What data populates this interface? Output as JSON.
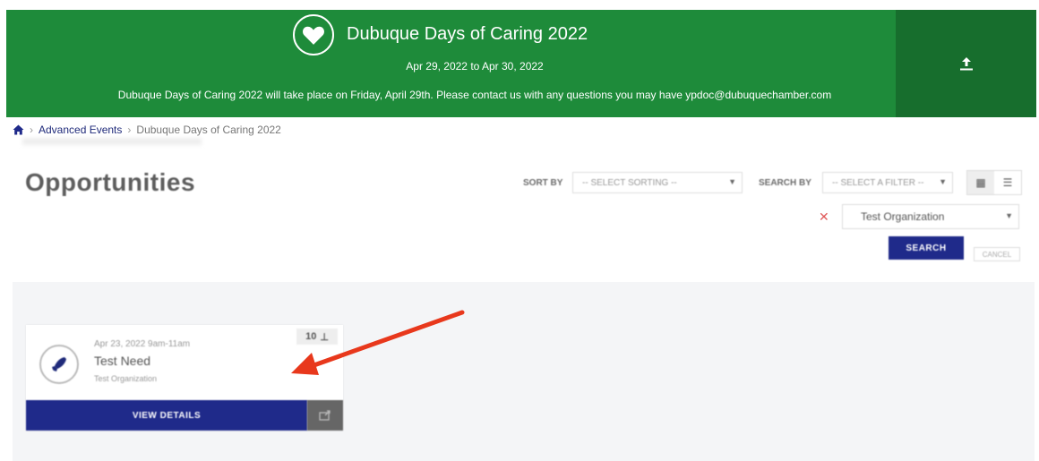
{
  "banner": {
    "title": "Dubuque Days of Caring 2022",
    "dates": "Apr 29, 2022 to Apr 30, 2022",
    "description": "Dubuque Days of Caring 2022 will take place on Friday, April 29th. Please contact us with any questions you may have ypdoc@dubuquechamber.com",
    "icon": "heart-icon",
    "share_icon": "upload-icon",
    "color": "#1e8b3a"
  },
  "breadcrumb": {
    "home_icon": "home-icon",
    "items": [
      "Advanced Events",
      "Dubuque Days of Caring 2022"
    ]
  },
  "page": {
    "title": "Opportunities"
  },
  "filters": {
    "sort_label": "SORT BY",
    "sort_value": "-- SELECT SORTING --",
    "search_label": "SEARCH BY",
    "search_value": "-- SELECT A FILTER --",
    "org_value": "Test Organization",
    "search_button": "SEARCH",
    "cancel_button": "CANCEL"
  },
  "card": {
    "date": "Apr 23, 2022  9am-11am",
    "title": "Test Need",
    "organization": "Test Organization",
    "count": "10",
    "view_details": "VIEW DETAILS"
  },
  "colors": {
    "primary": "#1f2a8a",
    "annotation_arrow": "#e8381c"
  }
}
